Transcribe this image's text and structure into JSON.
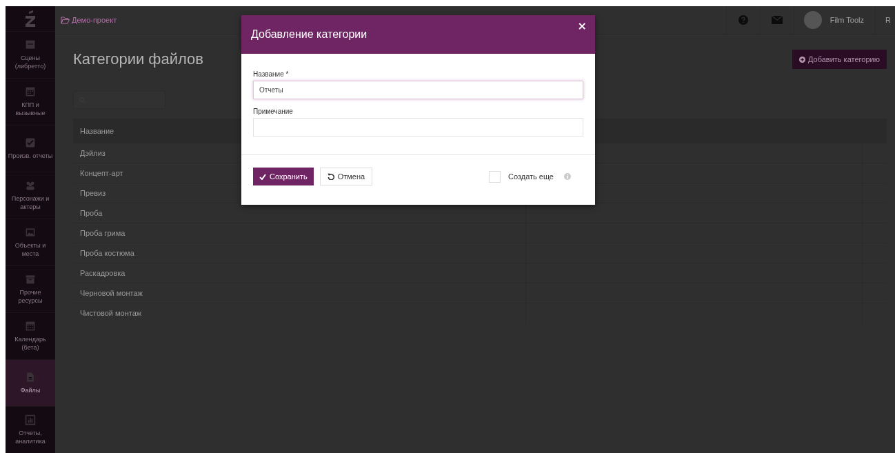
{
  "sidebar": {
    "items": [
      {
        "label": "Сцены (либретто)",
        "selected": false
      },
      {
        "label": "КПП и вызывные",
        "selected": false
      },
      {
        "label": "Произв. отчеты",
        "selected": false
      },
      {
        "label": "Персонажи и актеры",
        "selected": false
      },
      {
        "label": "Объекты и места",
        "selected": false
      },
      {
        "label": "Прочие ресурсы",
        "selected": false
      },
      {
        "label": "Календарь (бета)",
        "selected": false
      },
      {
        "label": "Файлы",
        "selected": true
      },
      {
        "label": "Отчеты, аналитика",
        "selected": false
      }
    ]
  },
  "top_bar": {
    "breadcrumb": "Демо-проект",
    "user_name": "Film Toolz",
    "language": "R"
  },
  "page": {
    "title": "Категории файлов",
    "add_button": "Добавить категорию",
    "table": {
      "columns": [
        "Название"
      ],
      "rows": [
        "Дэйлиз",
        "Концепт-арт",
        "Превиз",
        "Проба",
        "Проба грима",
        "Проба костюма",
        "Раскадровка",
        "Черновой монтаж",
        "Чистовой монтаж"
      ]
    }
  },
  "dialog": {
    "title": "Добавление категории",
    "close": "×",
    "fields": [
      {
        "label": "Название",
        "required_mark": "*",
        "value": "Отчеты",
        "focused": true
      },
      {
        "label": "Примечание",
        "focused": false
      }
    ],
    "save_button": "Сохранить",
    "cancel_button": "Отмена",
    "create_more": {
      "label": "Создать еще",
      "checked": false
    }
  }
}
